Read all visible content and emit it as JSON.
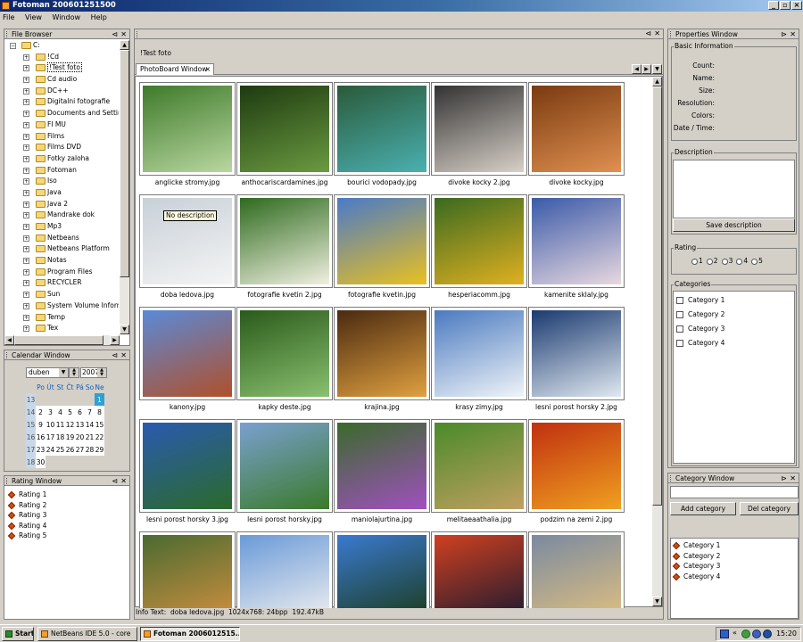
{
  "window": {
    "title": "Fotoman 200601251500"
  },
  "menu": [
    "File",
    "View",
    "Window",
    "Help"
  ],
  "file_browser": {
    "title": "File Browser",
    "root": "C:",
    "items": [
      "!Cd",
      "!Test foto",
      "Cd audio",
      "DC++",
      "Digitalni fotografie",
      "Documents and Settings",
      "FI MU",
      "Films",
      "Films DVD",
      "Fotky zaloha",
      "Fotoman",
      "Iso",
      "Java",
      "Java 2",
      "Mandrake dok",
      "Mp3",
      "Netbeans",
      "Netbeans Platform",
      "Notas",
      "Program Files",
      "RECYCLER",
      "Sun",
      "System Volume Informati",
      "Temp",
      "Tex"
    ],
    "selected_index": 1
  },
  "calendar": {
    "title": "Calendar Window",
    "month": "duben",
    "year": "2007",
    "weekdays": [
      "Po",
      "Út",
      "St",
      "Čt",
      "Pá",
      "So",
      "Ne"
    ],
    "weeks": [
      {
        "num": "13",
        "days": [
          "",
          "",
          "",
          "",
          "",
          "",
          "1"
        ]
      },
      {
        "num": "14",
        "days": [
          "2",
          "3",
          "4",
          "5",
          "6",
          "7",
          "8"
        ]
      },
      {
        "num": "15",
        "days": [
          "9",
          "10",
          "11",
          "12",
          "13",
          "14",
          "15"
        ]
      },
      {
        "num": "16",
        "days": [
          "16",
          "17",
          "18",
          "19",
          "20",
          "21",
          "22"
        ]
      },
      {
        "num": "17",
        "days": [
          "23",
          "24",
          "25",
          "26",
          "27",
          "28",
          "29"
        ]
      },
      {
        "num": "18",
        "days": [
          "30",
          "",
          "",
          "",
          "",
          "",
          ""
        ]
      }
    ],
    "selected_day": "1"
  },
  "rating_window": {
    "title": "Rating Window",
    "items": [
      "Rating 1",
      "Rating 2",
      "Rating 3",
      "Rating 4",
      "Rating 5"
    ]
  },
  "editor": {
    "breadcrumb": "!Test foto",
    "tab_label": "PhotoBoard Window",
    "tooltip": "No description",
    "photos": [
      {
        "name": "anglicke stromy.jpg",
        "c1": "#3e7a2a",
        "c2": "#b9d7a0"
      },
      {
        "name": "anthocariscardamines.jpg",
        "c1": "#1e3a10",
        "c2": "#6a9a40"
      },
      {
        "name": "bourici vodopady.jpg",
        "c1": "#2a5a3a",
        "c2": "#4ab0b0"
      },
      {
        "name": "divoke kocky 2.jpg",
        "c1": "#333333",
        "c2": "#d8d0c8"
      },
      {
        "name": "divoke kocky.jpg",
        "c1": "#7a3a10",
        "c2": "#e09050"
      },
      {
        "name": "doba ledova.jpg",
        "c1": "#c8d0d8",
        "c2": "#f4f4f4"
      },
      {
        "name": "fotografie kvetin 2.jpg",
        "c1": "#2e6a1e",
        "c2": "#f0f0e0"
      },
      {
        "name": "fotografie kvetin.jpg",
        "c1": "#4a7ac8",
        "c2": "#e8c020"
      },
      {
        "name": "hesperiacomm.jpg",
        "c1": "#3a6a20",
        "c2": "#e0b020"
      },
      {
        "name": "kamenite sklaly.jpg",
        "c1": "#3a5aa8",
        "c2": "#e8d8e0"
      },
      {
        "name": "kanony.jpg",
        "c1": "#5a8ad8",
        "c2": "#b0502a"
      },
      {
        "name": "kapky deste.jpg",
        "c1": "#2a5a1a",
        "c2": "#8ac070"
      },
      {
        "name": "krajina.jpg",
        "c1": "#4a2a10",
        "c2": "#e0a040"
      },
      {
        "name": "krasy zimy.jpg",
        "c1": "#4a7ac0",
        "c2": "#f0f4f8"
      },
      {
        "name": "lesni porost horsky 2.jpg",
        "c1": "#1a3a70",
        "c2": "#e0e8f0"
      },
      {
        "name": "lesni porost horsky 3.jpg",
        "c1": "#2a5ab0",
        "c2": "#2a6a2a"
      },
      {
        "name": "lesni porost horsky.jpg",
        "c1": "#7aa0d0",
        "c2": "#3a7a2a"
      },
      {
        "name": "maniolajurtina.jpg",
        "c1": "#3a6a2a",
        "c2": "#a050c0"
      },
      {
        "name": "melitaeaathalia.jpg",
        "c1": "#4a8a2a",
        "c2": "#c0a060"
      },
      {
        "name": "podzim na zemi 2.jpg",
        "c1": "#c03010",
        "c2": "#f0a020"
      },
      {
        "name": "",
        "c1": "#4a6a30",
        "c2": "#d09040"
      },
      {
        "name": "",
        "c1": "#6a9ad8",
        "c2": "#f0f0f0"
      },
      {
        "name": "",
        "c1": "#3a7ad0",
        "c2": "#1a3a1a"
      },
      {
        "name": "",
        "c1": "#d04020",
        "c2": "#1a1a30"
      },
      {
        "name": "",
        "c1": "#7a8aa0",
        "c2": "#e0c080"
      }
    ]
  },
  "info_bar": "Info Text:  doba ledova.jpg  1024x768: 24bpp  192.47kB",
  "properties": {
    "title": "Properties Window",
    "basic_title": "Basic Information",
    "labels": [
      "Count:",
      "Name:",
      "Size:",
      "Resolution:",
      "Colors:",
      "Date / Time:"
    ],
    "description_title": "Description",
    "save_button": "Save description",
    "rating_title": "Rating",
    "rating_options": [
      "1",
      "2",
      "3",
      "4",
      "5"
    ],
    "categories_title": "Categories",
    "categories": [
      "Category 1",
      "Category 2",
      "Category 3",
      "Category 4"
    ]
  },
  "category_window": {
    "title": "Category Window",
    "add_button": "Add category",
    "del_button": "Del category",
    "items": [
      "Category 1",
      "Category 2",
      "Category 3",
      "Category 4"
    ]
  },
  "taskbar": {
    "start": "Start",
    "tasks": [
      "NetBeans IDE 5.0 - core",
      "Fotoman 2006012515..."
    ],
    "time": "15:20"
  }
}
